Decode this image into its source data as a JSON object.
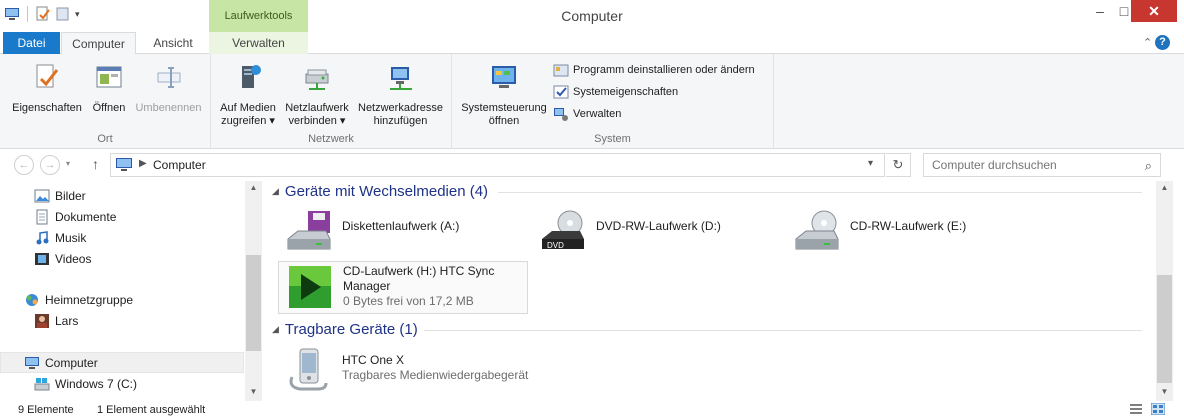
{
  "window": {
    "title": "Computer",
    "context_tab": "Laufwerktools",
    "controls": [
      "–",
      "□",
      "✕"
    ]
  },
  "ribbon_tabs": {
    "file": "Datei",
    "computer": "Computer",
    "view": "Ansicht",
    "manage": "Verwalten"
  },
  "ribbon": {
    "ort": {
      "label": "Ort",
      "properties": "Eigenschaften",
      "open": "Öffnen",
      "rename": "Umbenennen"
    },
    "netzwerk": {
      "label": "Netzwerk",
      "media_line1": "Auf Medien",
      "media_line2": "zugreifen ▾",
      "map_line1": "Netzlaufwerk",
      "map_line2": "verbinden ▾",
      "addnet_line1": "Netzwerkadresse",
      "addnet_line2": "hinzufügen"
    },
    "system": {
      "label": "System",
      "control_line1": "Systemsteuerung",
      "control_line2": "öffnen",
      "uninstall": "Programm deinstallieren oder ändern",
      "sysprops": "Systemeigenschaften",
      "manage": "Verwalten"
    }
  },
  "address": {
    "path": "Computer",
    "search_placeholder": "Computer durchsuchen"
  },
  "nav_pane": {
    "items": [
      {
        "label": "Bilder",
        "icon": "pictures-icon"
      },
      {
        "label": "Dokumente",
        "icon": "documents-icon"
      },
      {
        "label": "Musik",
        "icon": "music-icon"
      },
      {
        "label": "Videos",
        "icon": "videos-icon"
      },
      {
        "label": "Heimnetzgruppe",
        "icon": "homegroup-icon"
      },
      {
        "label": "Lars",
        "icon": "user-icon"
      },
      {
        "label": "Computer",
        "icon": "computer-icon"
      },
      {
        "label": "Windows 7 (C:)",
        "icon": "drive-icon"
      }
    ]
  },
  "content": {
    "removable_header": "Geräte mit Wechselmedien (4)",
    "portable_header": "Tragbare Geräte (1)",
    "drives": [
      {
        "name": "Diskettenlaufwerk (A:)"
      },
      {
        "name": "DVD-RW-Laufwerk (D:)"
      },
      {
        "name": "CD-RW-Laufwerk (E:)"
      },
      {
        "name_line1": "CD-Laufwerk (H:) HTC Sync",
        "name_line2": "Manager",
        "sub": "0 Bytes frei von 17,2 MB"
      }
    ],
    "portable": {
      "name": "HTC One X",
      "sub": "Tragbares Medienwiedergabegerät"
    }
  },
  "status": {
    "count": "9 Elemente",
    "selected": "1 Element ausgewählt"
  },
  "colors": {
    "accent": "#1979ca",
    "context_tab": "#c7e5a4",
    "close": "#c7372f",
    "section_header": "#1e3287"
  }
}
